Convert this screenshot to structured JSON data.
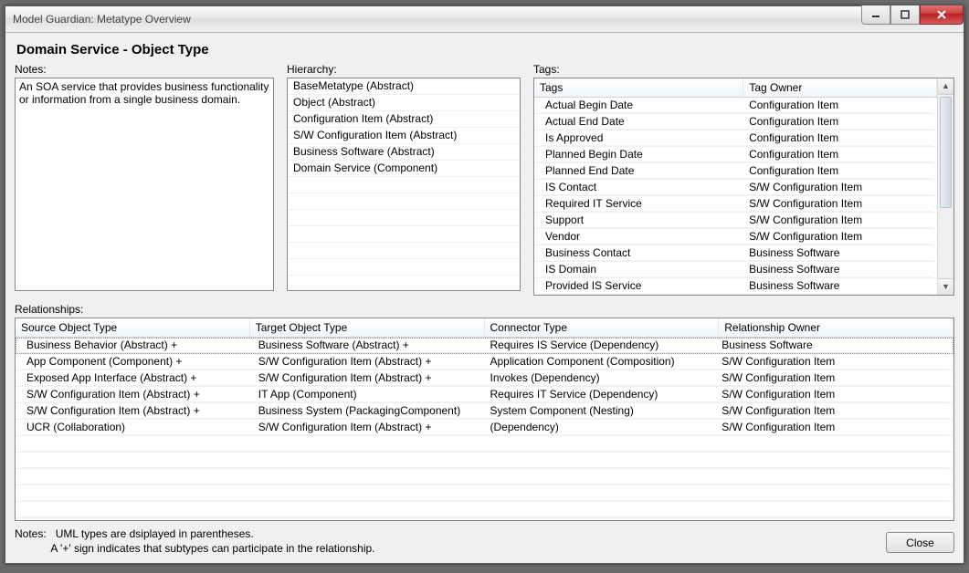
{
  "window": {
    "title": "Model Guardian: Metatype Overview"
  },
  "heading": "Domain Service - Object Type",
  "labels": {
    "notes": "Notes:",
    "hierarchy": "Hierarchy:",
    "tags": "Tags:",
    "relationships": "Relationships:"
  },
  "notes_text": "An SOA service that provides business functionality or information from a single business domain.",
  "hierarchy": [
    "BaseMetatype (Abstract)",
    "Object (Abstract)",
    "Configuration Item (Abstract)",
    "S/W Configuration Item (Abstract)",
    "Business Software (Abstract)",
    "Domain Service (Component)"
  ],
  "tags": {
    "columns": [
      "Tags",
      "Tag Owner"
    ],
    "rows": [
      [
        "Actual Begin Date",
        "Configuration Item"
      ],
      [
        "Actual End Date",
        "Configuration Item"
      ],
      [
        "Is Approved",
        "Configuration Item"
      ],
      [
        "Planned Begin Date",
        "Configuration Item"
      ],
      [
        "Planned End Date",
        "Configuration Item"
      ],
      [
        "IS Contact",
        "S/W Configuration Item"
      ],
      [
        "Required IT Service",
        "S/W Configuration Item"
      ],
      [
        "Support",
        "S/W Configuration Item"
      ],
      [
        "Vendor",
        "S/W Configuration Item"
      ],
      [
        "Business Contact",
        "Business Software"
      ],
      [
        "IS Domain",
        "Business Software"
      ],
      [
        "Provided IS Service",
        "Business Software"
      ]
    ]
  },
  "relationships": {
    "columns": [
      "Source Object Type",
      "Target Object Type",
      "Connector Type",
      "Relationship Owner"
    ],
    "rows": [
      [
        "Business Behavior (Abstract) +",
        "Business Software (Abstract) +",
        "Requires IS Service (Dependency)",
        "Business Software"
      ],
      [
        "App Component (Component) +",
        "S/W Configuration Item (Abstract) +",
        "Application Component (Composition)",
        "S/W Configuration Item"
      ],
      [
        "Exposed App Interface (Abstract) +",
        "S/W Configuration Item (Abstract) +",
        "Invokes (Dependency)",
        "S/W Configuration Item"
      ],
      [
        "S/W Configuration Item (Abstract) +",
        "IT App (Component)",
        "Requires IT Service (Dependency)",
        "S/W Configuration Item"
      ],
      [
        "S/W Configuration Item (Abstract) +",
        "Business System (PackagingComponent)",
        "System Component (Nesting)",
        "S/W Configuration Item"
      ],
      [
        "UCR (Collaboration)",
        "S/W Configuration Item (Abstract) +",
        "(Dependency)",
        "S/W Configuration Item"
      ]
    ]
  },
  "footer": {
    "label": "Notes:",
    "line1": "UML types are dsiplayed in parentheses.",
    "line2": "A '+' sign indicates that subtypes can participate in the relationship.",
    "close": "Close"
  }
}
